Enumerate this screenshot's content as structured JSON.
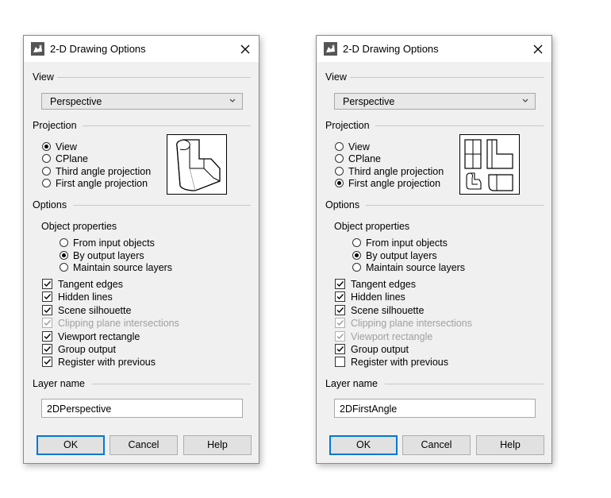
{
  "dialogs": [
    {
      "title": "2-D Drawing Options",
      "view_label": "View",
      "view_value": "Perspective",
      "projection_label": "Projection",
      "projection_options": [
        "View",
        "CPlane",
        "Third angle projection",
        "First angle projection"
      ],
      "projection_selected": 0,
      "options_label": "Options",
      "object_properties_label": "Object properties",
      "object_properties_options": [
        "From input objects",
        "By output layers",
        "Maintain source layers"
      ],
      "object_properties_selected": 1,
      "checkboxes": [
        {
          "label": "Tangent edges",
          "checked": true,
          "enabled": true
        },
        {
          "label": "Hidden lines",
          "checked": true,
          "enabled": true
        },
        {
          "label": "Scene silhouette",
          "checked": true,
          "enabled": true
        },
        {
          "label": "Clipping plane intersections",
          "checked": true,
          "enabled": false
        },
        {
          "label": "Viewport rectangle",
          "checked": true,
          "enabled": true
        },
        {
          "label": "Group output",
          "checked": true,
          "enabled": true
        },
        {
          "label": "Register with previous",
          "checked": true,
          "enabled": true
        }
      ],
      "layer_name_label": "Layer name",
      "layer_name_value": "2DPerspective",
      "ok_label": "OK",
      "cancel_label": "Cancel",
      "help_label": "Help"
    },
    {
      "title": "2-D Drawing Options",
      "view_label": "View",
      "view_value": "Perspective",
      "projection_label": "Projection",
      "projection_options": [
        "View",
        "CPlane",
        "Third angle projection",
        "First angle projection"
      ],
      "projection_selected": 3,
      "options_label": "Options",
      "object_properties_label": "Object properties",
      "object_properties_options": [
        "From input objects",
        "By output layers",
        "Maintain source layers"
      ],
      "object_properties_selected": 1,
      "checkboxes": [
        {
          "label": "Tangent edges",
          "checked": true,
          "enabled": true
        },
        {
          "label": "Hidden lines",
          "checked": true,
          "enabled": true
        },
        {
          "label": "Scene silhouette",
          "checked": true,
          "enabled": true
        },
        {
          "label": "Clipping plane intersections",
          "checked": true,
          "enabled": false
        },
        {
          "label": "Viewport rectangle",
          "checked": true,
          "enabled": false
        },
        {
          "label": "Group output",
          "checked": true,
          "enabled": true
        },
        {
          "label": "Register with previous",
          "checked": false,
          "enabled": true
        }
      ],
      "layer_name_label": "Layer name",
      "layer_name_value": "2DFirstAngle",
      "ok_label": "OK",
      "cancel_label": "Cancel",
      "help_label": "Help"
    }
  ]
}
